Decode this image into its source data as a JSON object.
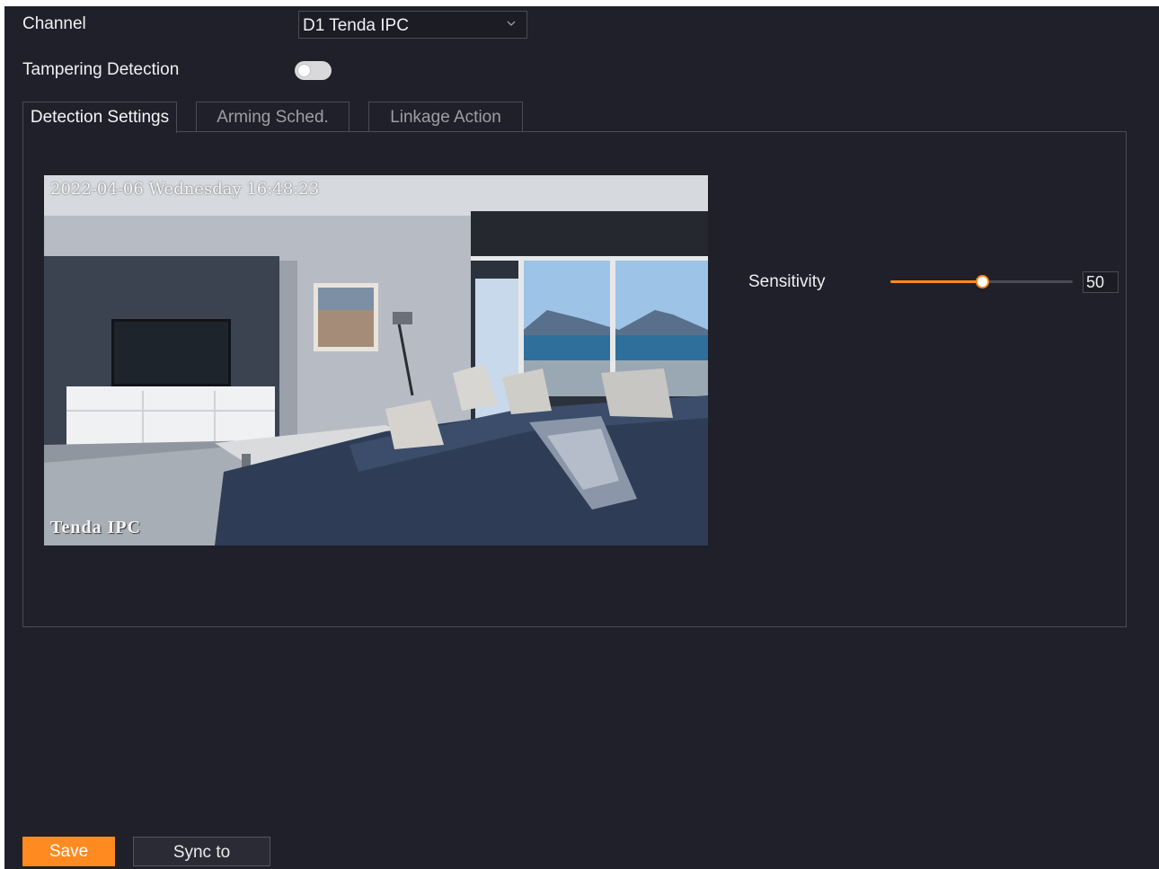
{
  "channel": {
    "label": "Channel",
    "selected": "D1 Tenda IPC",
    "icon": "chevron-down-icon"
  },
  "tampering": {
    "label": "Tampering Detection",
    "enabled": false
  },
  "tabs": [
    {
      "label": "Detection Settings",
      "active": true
    },
    {
      "label": "Arming Sched.",
      "active": false
    },
    {
      "label": "Linkage Action",
      "active": false
    }
  ],
  "preview": {
    "timestamp": "2022-04-06 Wednesday 16:48:23",
    "brand": "Tenda  IPC"
  },
  "sensitivity": {
    "label": "Sensitivity",
    "value": "50",
    "level_fraction": 0.5
  },
  "buttons": {
    "save": "Save",
    "sync": "Sync to"
  },
  "colors": {
    "accent": "#ff8a1f",
    "background": "#1f2029",
    "border": "#4a4b55"
  }
}
